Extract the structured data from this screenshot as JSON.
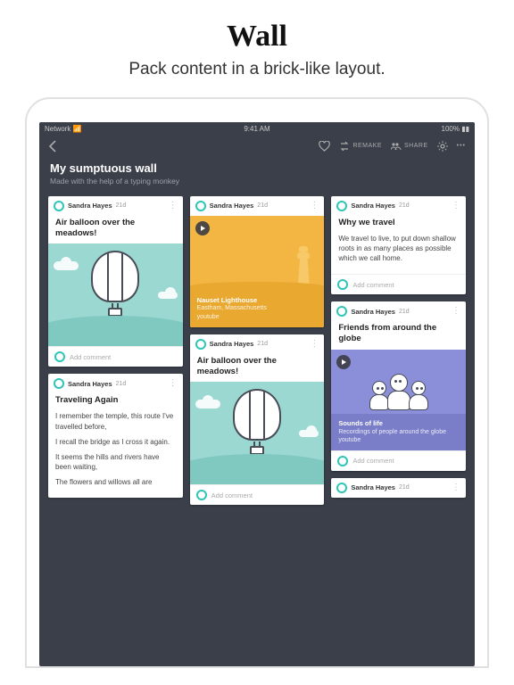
{
  "promo": {
    "title": "Wall",
    "subtitle": "Pack content in a brick-like layout."
  },
  "statusbar": {
    "network": "Network",
    "time": "9:41 AM",
    "battery": "100%"
  },
  "topbar": {
    "remake": "REMAKE",
    "share": "SHARE"
  },
  "header": {
    "title": "My sumptuous wall",
    "subtitle": "Made with the help of a typing monkey"
  },
  "common": {
    "author": "Sandra Hayes",
    "ago": "21d",
    "add_comment": "Add comment"
  },
  "cards": {
    "balloon1": {
      "title": "Air balloon over the meadows!"
    },
    "traveling": {
      "title": "Traveling Again",
      "p1": "I remember the temple, this route I've travelled before,",
      "p2": "I recall the bridge as I cross it again.",
      "p3": "It seems the hills and rivers have been waiting,",
      "p4": "The flowers and willows all are"
    },
    "lighthouse": {
      "ct": "Nauset Lighthouse",
      "cs1": "Eastham, Massachusetts",
      "cs2": "youtube"
    },
    "balloon2": {
      "title": "Air balloon over the meadows!"
    },
    "whytravel": {
      "title": "Why we travel",
      "body": "We travel to live, to put down shallow roots in as many places as possible which we call home."
    },
    "friends": {
      "title": "Friends from around the globe",
      "ct": "Sounds of life",
      "cs1": "Recordings of people around the globe",
      "cs2": "youtube"
    }
  }
}
